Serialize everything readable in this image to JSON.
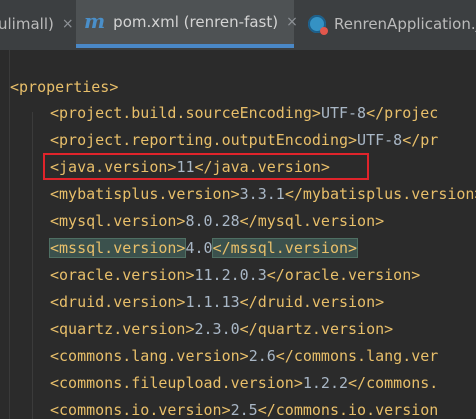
{
  "tabs": [
    {
      "label": "ulimall)",
      "close": "×"
    },
    {
      "label": "pom.xml (renren-fast)",
      "close": "×",
      "icon": "maven-m-icon"
    },
    {
      "label": "RenrenApplication.j",
      "icon": "java-class-icon"
    }
  ],
  "editor": {
    "properties_open": "<properties>",
    "lines": [
      {
        "open": "<project.build.sourceEncoding>",
        "value": "UTF-8",
        "close": "</projec"
      },
      {
        "open": "<project.reporting.outputEncoding>",
        "value": "UTF-8",
        "close": "</pr"
      },
      {
        "open": "<java.version>",
        "value": "11",
        "close": "</java.version>"
      },
      {
        "open": "<mybatisplus.version>",
        "value": "3.3.1",
        "close": "</mybatisplus.version>"
      },
      {
        "open": "<mysql.version>",
        "value": "8.0.28",
        "close": "</mysql.version>"
      },
      {
        "open": "<mssql.version>",
        "value": "4.0",
        "close": "</mssql.version>"
      },
      {
        "open": "<oracle.version>",
        "value": "11.2.0.3",
        "close": "</oracle.version>"
      },
      {
        "open": "<druid.version>",
        "value": "1.1.13",
        "close": "</druid.version>"
      },
      {
        "open": "<quartz.version>",
        "value": "2.3.0",
        "close": "</quartz.version>"
      },
      {
        "open": "<commons.lang.version>",
        "value": "2.6",
        "close": "</commons.lang.ver"
      },
      {
        "open": "<commons.fileupload.version>",
        "value": "1.2.2",
        "close": "</commons."
      },
      {
        "open": "<commons.io.version>",
        "value": "2.5",
        "close": "</commons.io.version"
      }
    ]
  },
  "colors": {
    "tag": "#e8bf6a",
    "text": "#a9b7c6",
    "background": "#2b2b2b",
    "highlight_box": "#e0242b",
    "matched_tag_bg": "#3b514d"
  }
}
